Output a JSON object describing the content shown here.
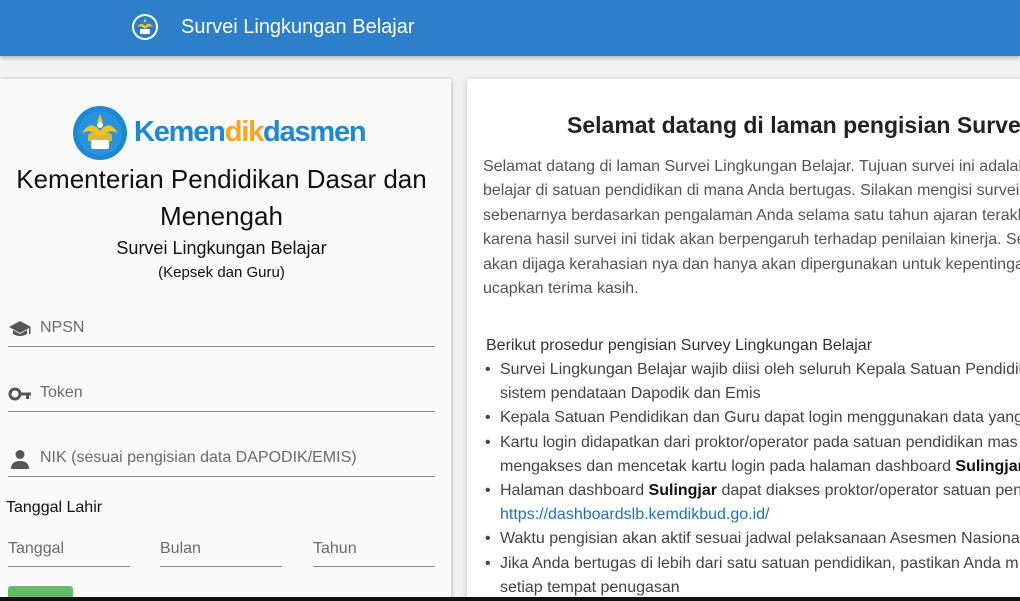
{
  "header": {
    "title": "Survei Lingkungan Belajar",
    "logo_icon": "tut-wuri-handayani-emblem-icon",
    "bg_color": "#2c7fc8"
  },
  "login": {
    "brand": {
      "part1": "Kemen",
      "part2": "dik",
      "part3": "dasmen",
      "colors": [
        "#1d88d4",
        "#f5a623",
        "#1d88d4"
      ]
    },
    "ministry": "Kementerian Pendidikan Dasar dan Menengah",
    "subtitle": "Survei Lingkungan Belajar",
    "audience": "(Kepsek dan Guru)",
    "fields": {
      "npsn": {
        "placeholder": "NPSN",
        "value": "",
        "icon": "graduation-cap-icon"
      },
      "token": {
        "placeholder": "Token",
        "value": "",
        "icon": "key-icon"
      },
      "nik": {
        "placeholder": "NIK (sesuai pengisian data DAPODIK/EMIS)",
        "value": "",
        "icon": "person-icon"
      }
    },
    "dob": {
      "label": "Tanggal Lahir",
      "day_placeholder": "Tanggal",
      "month_placeholder": "Bulan",
      "year_placeholder": "Tahun"
    },
    "submit_color": "#66bb6a"
  },
  "info": {
    "welcome": "Selamat datang di laman pengisian Survei",
    "intro_lines": [
      "Selamat datang di laman Survei Lingkungan Belajar. Tujuan survei ini adalah",
      "belajar di satuan pendidikan di mana Anda bertugas. Silakan mengisi survei",
      "sebenarnya berdasarkan pengalaman Anda selama satu tahun ajaran terakh",
      "karena hasil survei ini tidak akan berpengaruh terhadap penilaian kinerja. Se",
      "akan dijaga kerahasian nya dan hanya akan dipergunakan untuk kepentingan",
      "ucapkan terima kasih."
    ],
    "procedure_title": "Berikut prosedur pengisian Survey Lingkungan Belajar",
    "steps": {
      "s1a": "Survei Lingkungan Belajar wajib diisi oleh seluruh Kepala Satuan Pendidik",
      "s1b": "sistem pendataan Dapodik dan Emis",
      "s2": "Kepala Satuan Pendidikan dan Guru dapat login menggunakan data yang",
      "s3a": "Kartu login didapatkan dari proktor/operator pada satuan pendidikan mas",
      "s3b_pre": "mengakses dan mencetak kartu login pada halaman dashboard ",
      "s3b_bold": "Sulingjar",
      "s4_pre": "Halaman dashboard ",
      "s4_bold": "Sulingjar",
      "s4_post": " dapat diakses proktor/operator satuan pen",
      "s4_link": "https://dashboardslb.kemdikbud.go.id/",
      "s5": "Waktu pengisian akan aktif sesuai jadwal pelaksanaan Asesmen Nasiona",
      "s6a": "Jika Anda bertugas di lebih dari satu satuan pendidikan, pastikan Anda m",
      "s6b": "setiap tempat penugasan"
    },
    "link_color": "#1a73c8"
  }
}
